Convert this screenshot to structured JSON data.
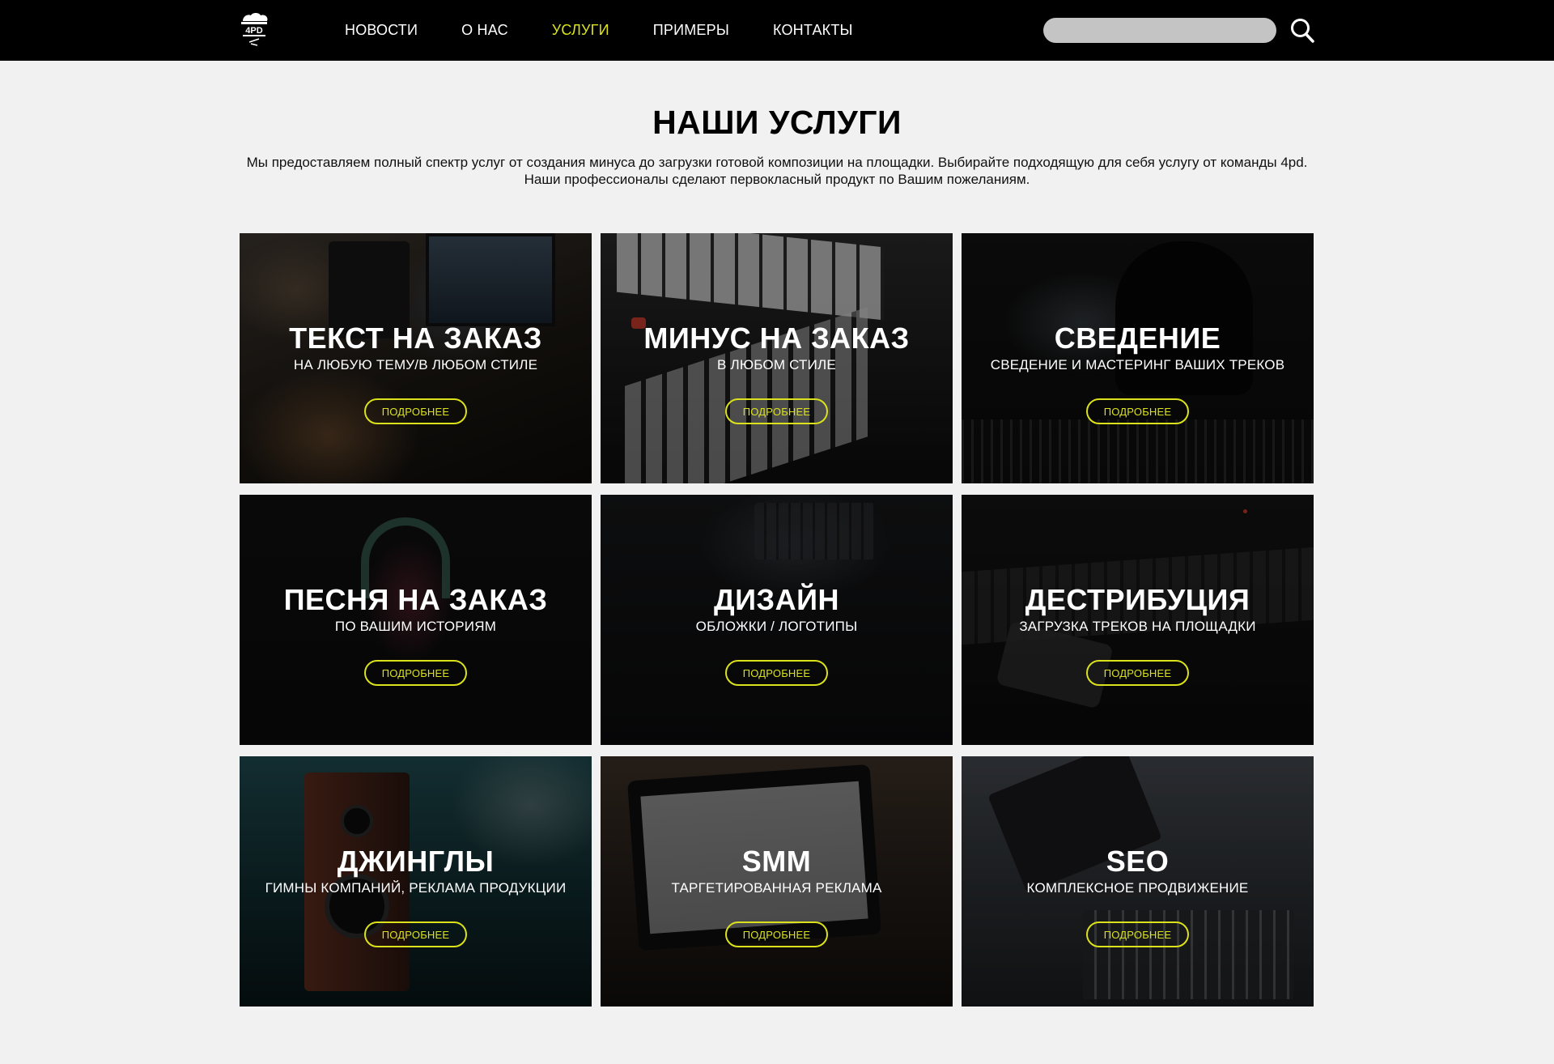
{
  "header": {
    "logo_alt": "4pd",
    "nav": [
      {
        "label": "НОВОСТИ",
        "active": false
      },
      {
        "label": "О НАС",
        "active": false
      },
      {
        "label": "УСЛУГИ",
        "active": true
      },
      {
        "label": "ПРИМЕРЫ",
        "active": false
      },
      {
        "label": "КОНТАКТЫ",
        "active": false
      }
    ],
    "search": {
      "value": "",
      "placeholder": ""
    },
    "search_icon": "search-icon"
  },
  "main": {
    "title": "НАШИ УСЛУГИ",
    "intro": "Мы предоставляем полный спектр услуг от создания минуса до загрузки готовой композиции на площадки. Выбирайте подходящую для себя услугу от команды 4pd. Наши профессионалы сделают первокласный продукт по Вашим пожеланиям.",
    "services": [
      {
        "title": "ТЕКСТ НА ЗАКАЗ",
        "subtitle": "НА ЛЮБУЮ ТЕМУ/В ЛЮБОМ СТИЛЕ",
        "button": "ПОДРОБНЕЕ"
      },
      {
        "title": "МИНУС НА ЗАКАЗ",
        "subtitle": "В ЛЮБОМ СТИЛЕ",
        "button": "ПОДРОБНЕЕ"
      },
      {
        "title": "СВЕДЕНИЕ",
        "subtitle": "СВЕДЕНИЕ И МАСТЕРИНГ ВАШИХ ТРЕКОВ",
        "button": "ПОДРОБНЕЕ"
      },
      {
        "title": "ПЕСНЯ НА ЗАКАЗ",
        "subtitle": "ПО ВАШИМ ИСТОРИЯМ",
        "button": "ПОДРОБНЕЕ"
      },
      {
        "title": "ДИЗАЙН",
        "subtitle": "ОБЛОЖКИ / ЛОГОТИПЫ",
        "button": "ПОДРОБНЕЕ"
      },
      {
        "title": "ДЕСТРИБУЦИЯ",
        "subtitle": "ЗАГРУЗКА ТРЕКОВ НА ПЛОЩАДКИ",
        "button": "ПОДРОБНЕЕ"
      },
      {
        "title": "ДЖИНГЛЫ",
        "subtitle": "ГИМНЫ КОМПАНИЙ, РЕКЛАМА ПРОДУКЦИИ",
        "button": "ПОДРОБНЕЕ"
      },
      {
        "title": "SMM",
        "subtitle": "ТАРГЕТИРОВАННАЯ РЕКЛАМА",
        "button": "ПОДРОБНЕЕ"
      },
      {
        "title": "SEO",
        "subtitle": "КОМПЛЕКСНОЕ ПРОДВИЖЕНИЕ",
        "button": "ПОДРОБНЕЕ"
      }
    ]
  },
  "colors": {
    "header_bg": "#000000",
    "page_bg": "#f1f1f1",
    "accent": "#dbe21c",
    "search_bg": "#c4c4c4"
  }
}
